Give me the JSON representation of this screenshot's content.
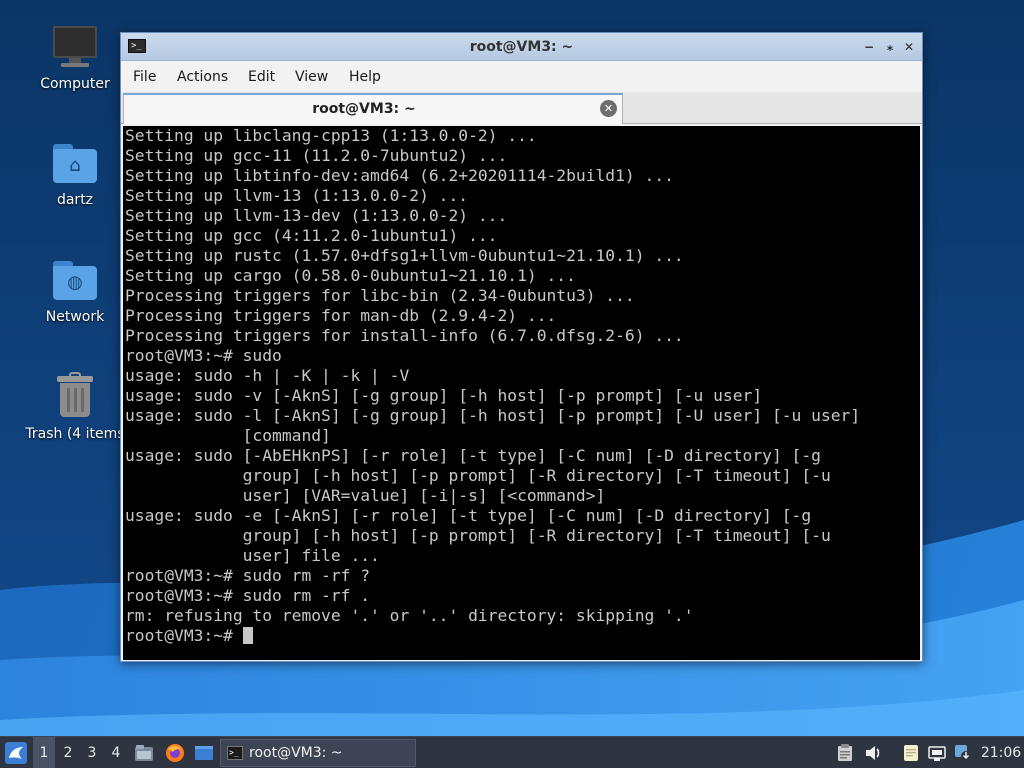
{
  "desktop": {
    "icons": [
      {
        "label": "Computer",
        "icon": "computer-icon"
      },
      {
        "label": "dartz",
        "icon": "home-folder-icon"
      },
      {
        "label": "Network",
        "icon": "network-folder-icon"
      },
      {
        "label": "Trash (4 items",
        "icon": "trash-icon"
      }
    ]
  },
  "window": {
    "title": "root@VM3: ~",
    "controls": {
      "minimize": "−",
      "maximize": "⁎",
      "close": "✕"
    },
    "menu": [
      "File",
      "Actions",
      "Edit",
      "View",
      "Help"
    ],
    "tab": {
      "label": "root@VM3: ~",
      "close": "✕"
    },
    "terminal_lines": [
      "Setting up libclang-cpp13 (1:13.0.0-2) ...",
      "Setting up gcc-11 (11.2.0-7ubuntu2) ...",
      "Setting up libtinfo-dev:amd64 (6.2+20201114-2build1) ...",
      "Setting up llvm-13 (1:13.0.0-2) ...",
      "Setting up llvm-13-dev (1:13.0.0-2) ...",
      "Setting up gcc (4:11.2.0-1ubuntu1) ...",
      "Setting up rustc (1.57.0+dfsg1+llvm-0ubuntu1~21.10.1) ...",
      "Setting up cargo (0.58.0-0ubuntu1~21.10.1) ...",
      "Processing triggers for libc-bin (2.34-0ubuntu3) ...",
      "Processing triggers for man-db (2.9.4-2) ...",
      "Processing triggers for install-info (6.7.0.dfsg.2-6) ...",
      "root@VM3:~# sudo",
      "usage: sudo -h | -K | -k | -V",
      "usage: sudo -v [-AknS] [-g group] [-h host] [-p prompt] [-u user]",
      "usage: sudo -l [-AknS] [-g group] [-h host] [-p prompt] [-U user] [-u user]",
      "            [command]",
      "usage: sudo [-AbEHknPS] [-r role] [-t type] [-C num] [-D directory] [-g",
      "            group] [-h host] [-p prompt] [-R directory] [-T timeout] [-u",
      "            user] [VAR=value] [-i|-s] [<command>]",
      "usage: sudo -e [-AknS] [-r role] [-t type] [-C num] [-D directory] [-g",
      "            group] [-h host] [-p prompt] [-R directory] [-T timeout] [-u",
      "            user] file ...",
      "root@VM3:~# sudo rm -rf ?",
      "root@VM3:~# sudo rm -rf .",
      "rm: refusing to remove '.' or '..' directory: skipping '.'"
    ],
    "prompt": "root@VM3:~# "
  },
  "taskbar": {
    "start_icon": "start-menu-icon",
    "desktops": [
      "1",
      "2",
      "3",
      "4"
    ],
    "active_desktop": "1",
    "launchers": [
      "file-manager-icon",
      "firefox-icon",
      "show-desktop-icon"
    ],
    "task": {
      "label": "root@VM3: ~",
      "icon": "terminal-icon"
    },
    "tray": [
      "clipboard-icon",
      "volume-icon",
      "notes-icon",
      "network-icon",
      "update-notifier-icon"
    ],
    "clock": "21:06"
  }
}
